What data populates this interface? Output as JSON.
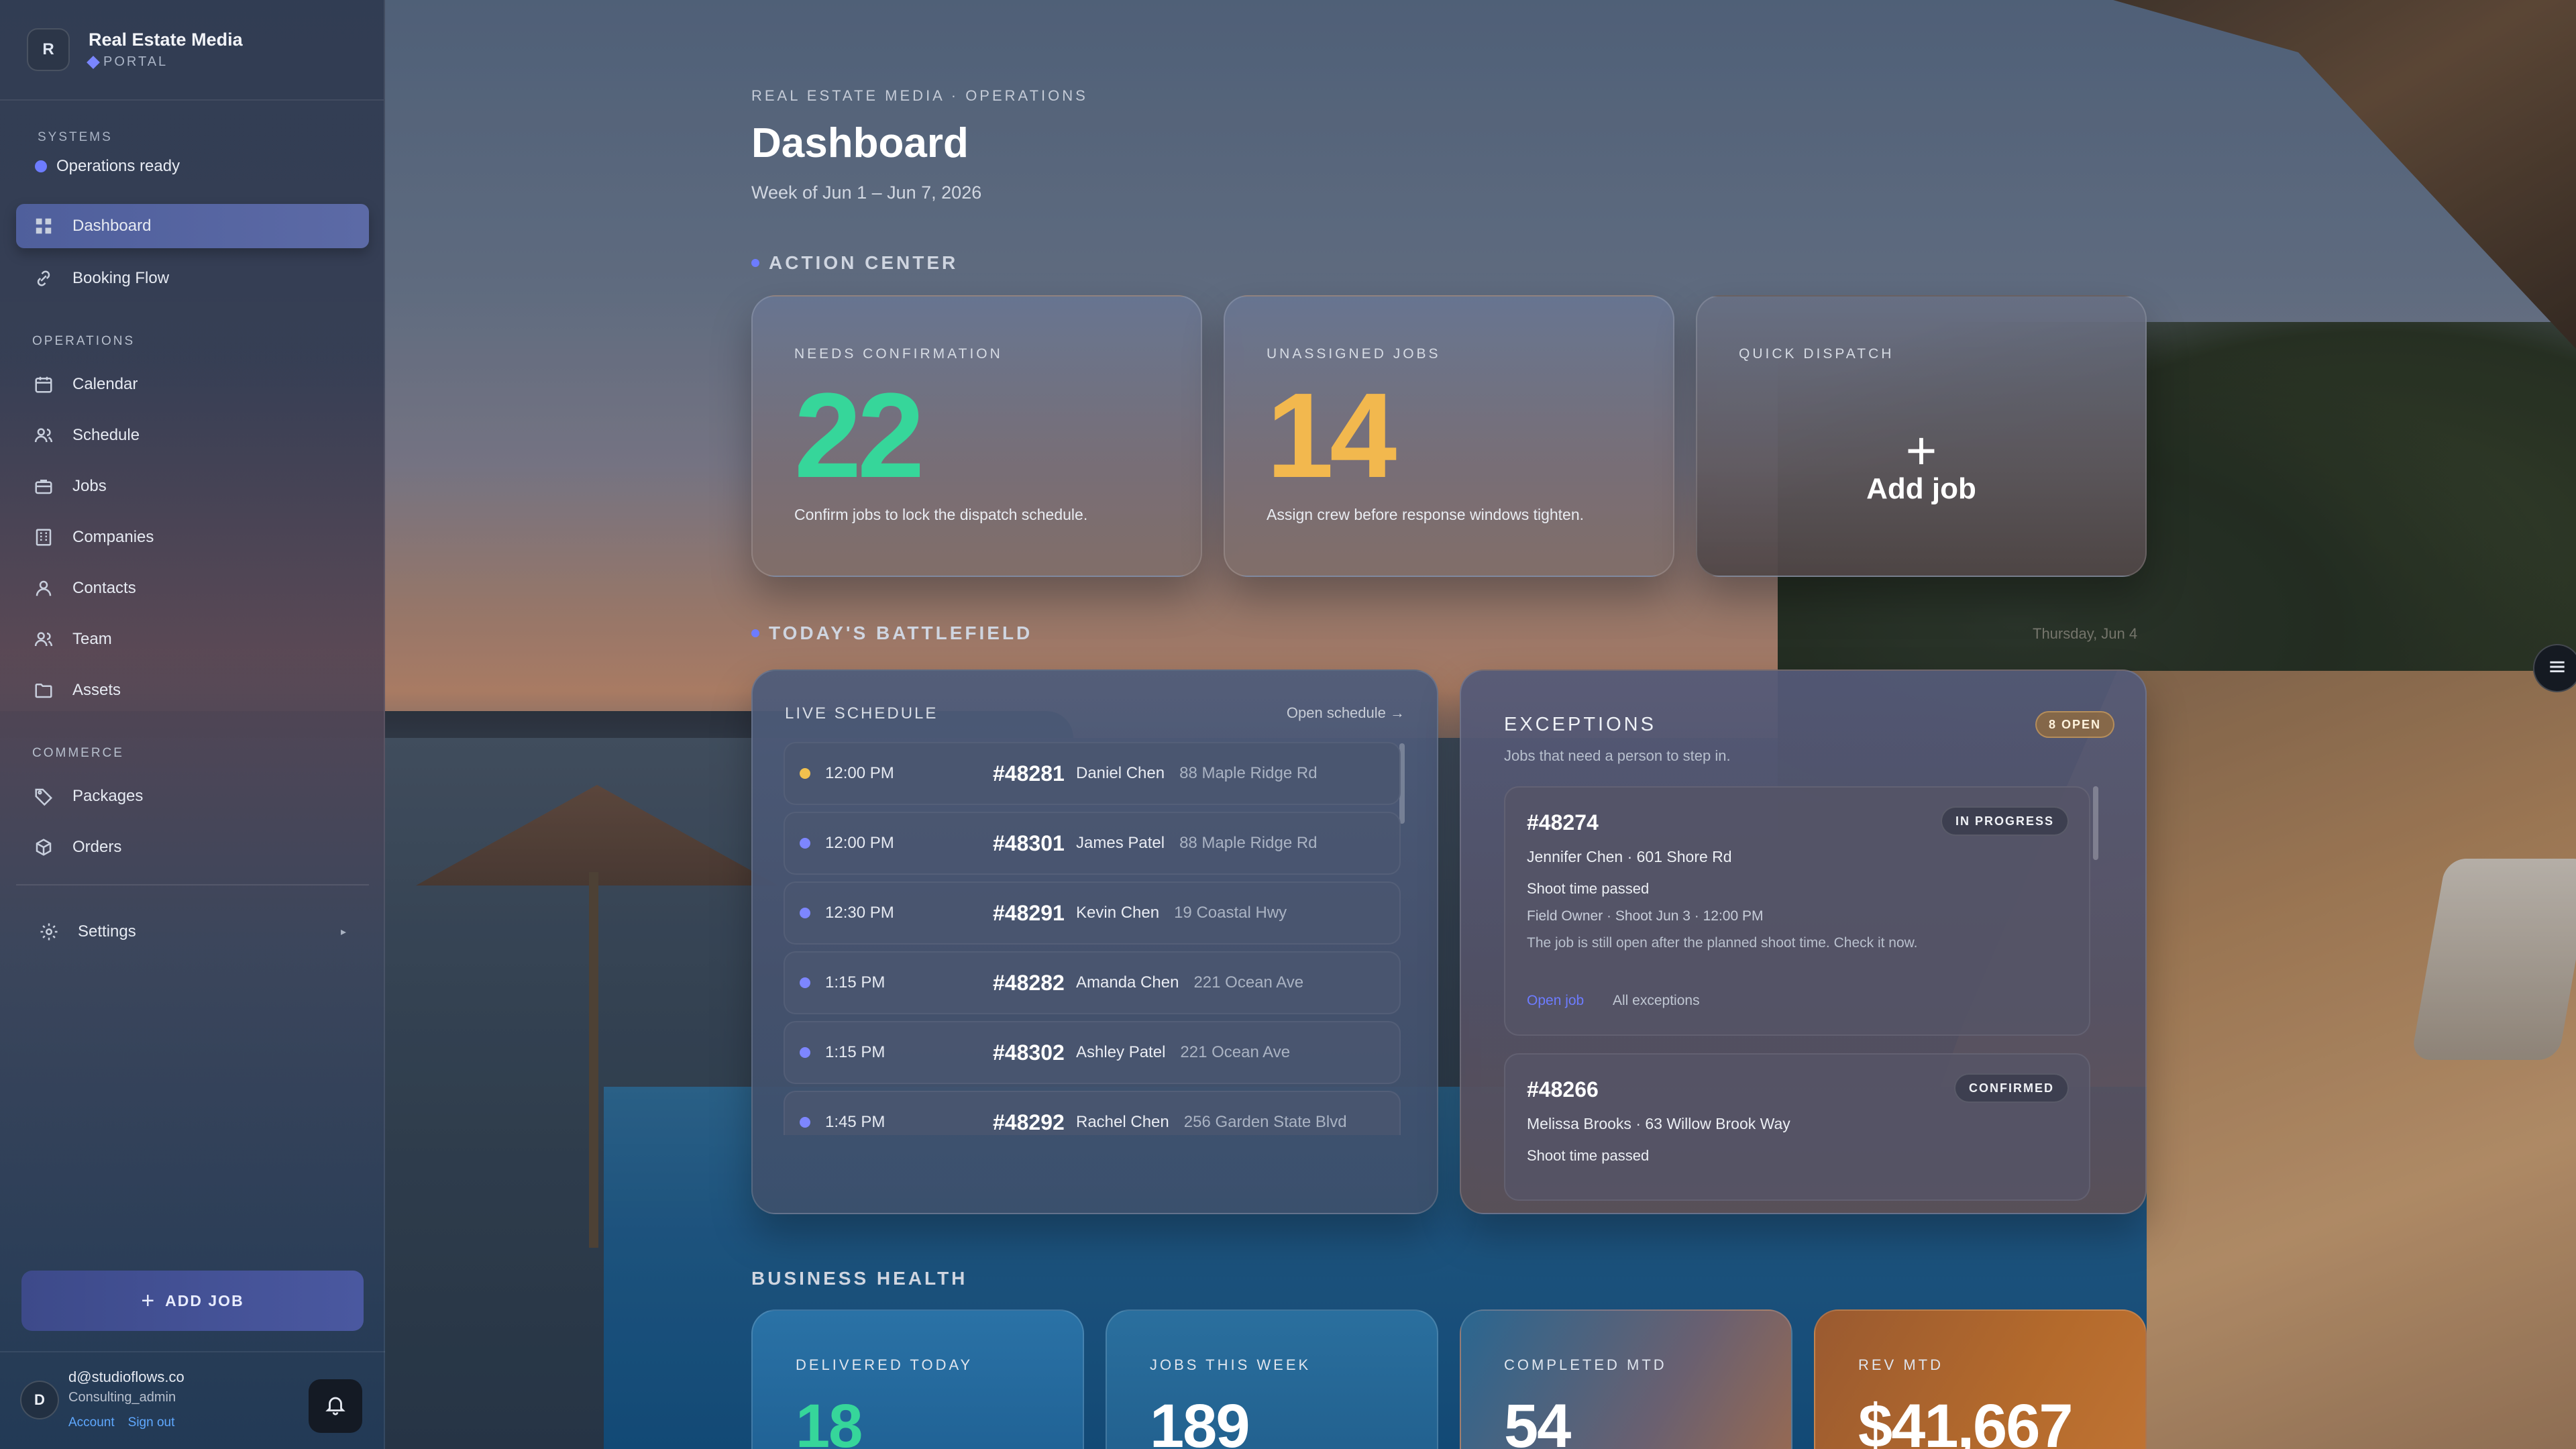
{
  "brand": {
    "initial": "R",
    "name": "Real Estate Media",
    "sub": "PORTAL"
  },
  "systems": {
    "label": "SYSTEMS",
    "status": "Operations ready"
  },
  "nav": {
    "dashboard": "Dashboard",
    "booking_flow": "Booking Flow",
    "operations_label": "OPERATIONS",
    "calendar": "Calendar",
    "schedule": "Schedule",
    "jobs": "Jobs",
    "companies": "Companies",
    "contacts": "Contacts",
    "team": "Team",
    "assets": "Assets",
    "commerce_label": "COMMERCE",
    "packages": "Packages",
    "orders": "Orders",
    "settings": "Settings",
    "settings_caret": "▸"
  },
  "sidebar_add_job": "ADD JOB",
  "user": {
    "initial": "D",
    "email": "d@studioflows.co",
    "role": "Consulting_admin",
    "account_link": "Account",
    "signout_link": "Sign out"
  },
  "header": {
    "crumb": "REAL ESTATE MEDIA · OPERATIONS",
    "title": "Dashboard",
    "subtitle": "Week of Jun 1 – Jun 7, 2026"
  },
  "action_center": {
    "heading": "ACTION CENTER",
    "needs_confirmation": {
      "label": "NEEDS CONFIRMATION",
      "value": "22",
      "note": "Confirm jobs to lock the dispatch schedule.",
      "color": "#36d69a"
    },
    "unassigned_jobs": {
      "label": "UNASSIGNED JOBS",
      "value": "14",
      "note": "Assign crew before response windows tighten.",
      "color": "#f2b84e"
    },
    "quick_dispatch": {
      "label": "QUICK DISPATCH",
      "plus": "+",
      "action": "Add job"
    }
  },
  "battlefield": {
    "heading": "TODAY'S BATTLEFIELD",
    "date_hint": "Thursday, Jun 4"
  },
  "live_schedule": {
    "title": "LIVE SCHEDULE",
    "open_link": "Open schedule →",
    "rows": [
      {
        "time": "12:00 PM",
        "id": "#48281",
        "name": "Daniel Chen",
        "address": "88 Maple Ridge Rd",
        "dot": "#f2c14e"
      },
      {
        "time": "12:00 PM",
        "id": "#48301",
        "name": "James Patel",
        "address": "88 Maple Ridge Rd",
        "dot": "#7d86ff"
      },
      {
        "time": "12:30 PM",
        "id": "#48291",
        "name": "Kevin Chen",
        "address": "19 Coastal Hwy",
        "dot": "#7d86ff"
      },
      {
        "time": "1:15 PM",
        "id": "#48282",
        "name": "Amanda Chen",
        "address": "221 Ocean Ave",
        "dot": "#7d86ff"
      },
      {
        "time": "1:15 PM",
        "id": "#48302",
        "name": "Ashley Patel",
        "address": "221 Ocean Ave",
        "dot": "#7d86ff"
      },
      {
        "time": "1:45 PM",
        "id": "#48292",
        "name": "Rachel Chen",
        "address": "256 Garden State Blvd",
        "dot": "#7d86ff"
      }
    ]
  },
  "exceptions": {
    "title": "EXCEPTIONS",
    "subtitle": "Jobs that need a person to step in.",
    "open_count": "8 OPEN",
    "items": [
      {
        "id": "#48274",
        "badge": "IN PROGRESS",
        "who": "Jennifer Chen · 601 Shore Rd",
        "issue": "Shoot time passed",
        "meta": "Field Owner · Shoot Jun 3 · 12:00 PM",
        "desc": "The job is still open after the planned shoot time. Check it now.",
        "open_job": "Open job",
        "all_exceptions": "All exceptions"
      },
      {
        "id": "#48266",
        "badge": "CONFIRMED",
        "who": "Melissa Brooks · 63 Willow Brook Way",
        "issue": "Shoot time passed"
      }
    ]
  },
  "business_health": {
    "heading": "BUSINESS HEALTH",
    "cards": [
      {
        "label": "DELIVERED TODAY",
        "value": "18"
      },
      {
        "label": "JOBS THIS WEEK",
        "value": "189"
      },
      {
        "label": "COMPLETED MTD",
        "value": "54"
      },
      {
        "label": "REV MTD",
        "value": "$41,667"
      }
    ]
  },
  "colors": {
    "accent": "#6d7cff",
    "green": "#36d69a",
    "amber": "#f2b84e",
    "link_blue": "#5fa8ff"
  }
}
